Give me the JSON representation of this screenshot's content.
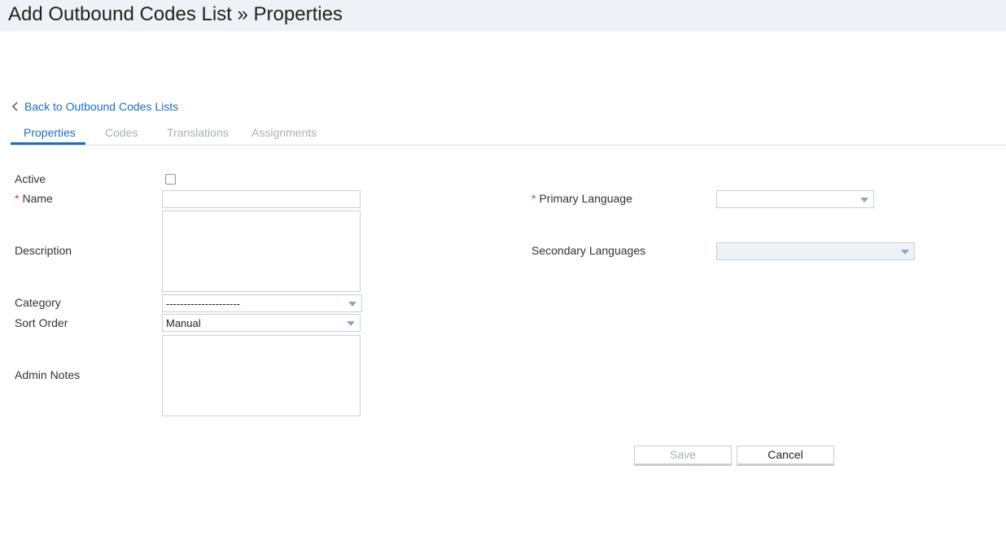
{
  "header": {
    "title": "Add Outbound Codes List » Properties"
  },
  "back_link": {
    "label": "Back to Outbound Codes Lists"
  },
  "tabs": [
    {
      "label": "Properties",
      "active": true
    },
    {
      "label": "Codes",
      "active": false
    },
    {
      "label": "Translations",
      "active": false
    },
    {
      "label": "Assignments",
      "active": false
    }
  ],
  "form": {
    "active": {
      "label": "Active",
      "checked": false
    },
    "name": {
      "label": "Name",
      "required_mark": "*",
      "value": ""
    },
    "description": {
      "label": "Description",
      "value": ""
    },
    "category": {
      "label": "Category",
      "selected": "---------------------"
    },
    "sort_order": {
      "label": "Sort Order",
      "selected": "Manual"
    },
    "admin_notes": {
      "label": "Admin Notes",
      "value": ""
    },
    "primary_language": {
      "label": "Primary Language",
      "required_mark": "*",
      "selected": ""
    },
    "secondary_languages": {
      "label": "Secondary Languages",
      "selected": ""
    }
  },
  "actions": {
    "save_label": "Save",
    "cancel_label": "Cancel"
  },
  "colors": {
    "accent": "#1a6fbf",
    "header_bg": "#eef1f5",
    "required": "#d33333",
    "muted": "#a7b0bb"
  }
}
